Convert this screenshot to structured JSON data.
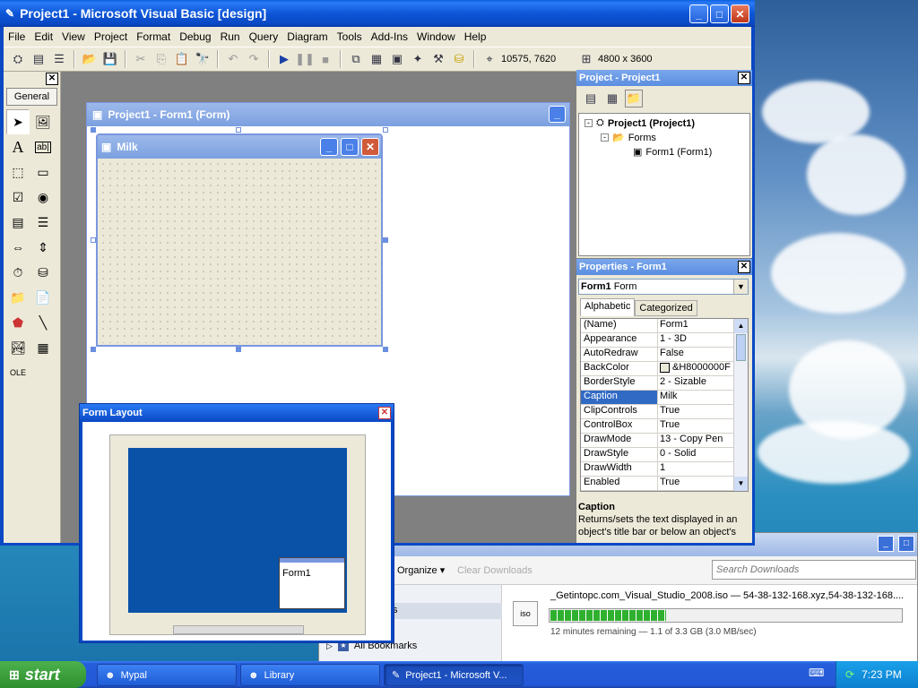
{
  "vb": {
    "title": "Project1 - Microsoft Visual Basic [design]",
    "menus": [
      "File",
      "Edit",
      "View",
      "Project",
      "Format",
      "Debug",
      "Run",
      "Query",
      "Diagram",
      "Tools",
      "Add-Ins",
      "Window",
      "Help"
    ],
    "position_readout": "10575, 7620",
    "size_readout": "4800 x 3600"
  },
  "toolbox": {
    "tab": "General"
  },
  "designer": {
    "title": "Project1 - Form1 (Form)"
  },
  "milk_form": {
    "title": "Milk"
  },
  "project_panel": {
    "title": "Project - Project1",
    "root": "Project1 (Project1)",
    "folder": "Forms",
    "item": "Form1 (Form1)"
  },
  "properties_panel": {
    "title": "Properties - Form1",
    "object_bold": "Form1",
    "object_type": "Form",
    "tab_alpha": "Alphabetic",
    "tab_cat": "Categorized",
    "rows": [
      {
        "k": "(Name)",
        "v": "Form1"
      },
      {
        "k": "Appearance",
        "v": "1 - 3D"
      },
      {
        "k": "AutoRedraw",
        "v": "False"
      },
      {
        "k": "BackColor",
        "v": "&H8000000F"
      },
      {
        "k": "BorderStyle",
        "v": "2 - Sizable"
      },
      {
        "k": "Caption",
        "v": "Milk"
      },
      {
        "k": "ClipControls",
        "v": "True"
      },
      {
        "k": "ControlBox",
        "v": "True"
      },
      {
        "k": "DrawMode",
        "v": "13 - Copy Pen"
      },
      {
        "k": "DrawStyle",
        "v": "0 - Solid"
      },
      {
        "k": "DrawWidth",
        "v": "1"
      },
      {
        "k": "Enabled",
        "v": "True"
      }
    ],
    "desc_title": "Caption",
    "desc_text": "Returns/sets the text displayed in an object's title bar or below an object's"
  },
  "form_layout": {
    "title": "Form Layout",
    "form_label": "Form1"
  },
  "downloads": {
    "organize": "Organize",
    "clear": "Clear Downloads",
    "search_placeholder": "Search Downloads",
    "file": "_Getintopc.com_Visual_Studio_2008.iso — 54-38-132-168.xyz,54-38-132-168....",
    "status": "12 minutes remaining — 1.1 of 3.3 GB (3.0 MB/sec)",
    "progress_fraction": 0.33,
    "sidebar_item": "All Bookmarks",
    "sidebar_partial": "s"
  },
  "taskbar": {
    "start": "start",
    "items": [
      "Mypal",
      "Library",
      "Project1 - Microsoft V..."
    ],
    "clock": "7:23 PM"
  }
}
